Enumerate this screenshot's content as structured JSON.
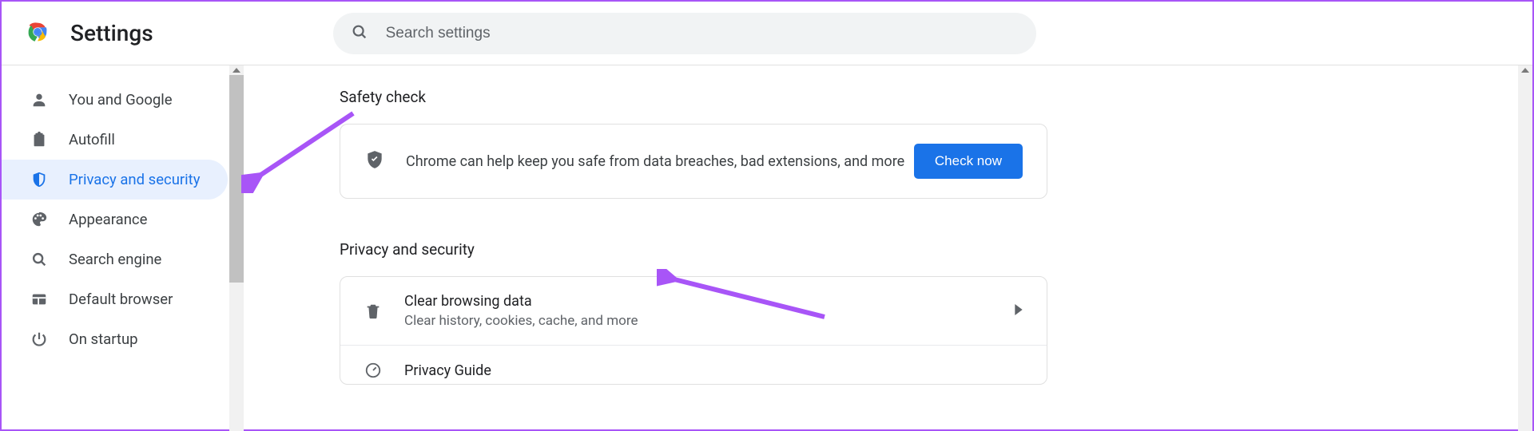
{
  "header": {
    "title": "Settings",
    "search_placeholder": "Search settings"
  },
  "sidebar": {
    "items": [
      {
        "icon": "person-icon",
        "label": "You and Google",
        "active": false
      },
      {
        "icon": "clipboard-icon",
        "label": "Autofill",
        "active": false
      },
      {
        "icon": "shield-icon",
        "label": "Privacy and security",
        "active": true
      },
      {
        "icon": "palette-icon",
        "label": "Appearance",
        "active": false
      },
      {
        "icon": "search-icon",
        "label": "Search engine",
        "active": false
      },
      {
        "icon": "browser-icon",
        "label": "Default browser",
        "active": false
      },
      {
        "icon": "power-icon",
        "label": "On startup",
        "active": false
      }
    ]
  },
  "content": {
    "safety": {
      "heading": "Safety check",
      "text": "Chrome can help keep you safe from data breaches, bad extensions, and more",
      "button": "Check now"
    },
    "privacy": {
      "heading": "Privacy and security",
      "rows": [
        {
          "icon": "trash-icon",
          "title": "Clear browsing data",
          "sub": "Clear history, cookies, cache, and more"
        },
        {
          "icon": "gauge-icon",
          "title": "Privacy Guide",
          "sub": ""
        }
      ]
    }
  },
  "annotations": {
    "arrow_color": "#a855f7"
  }
}
